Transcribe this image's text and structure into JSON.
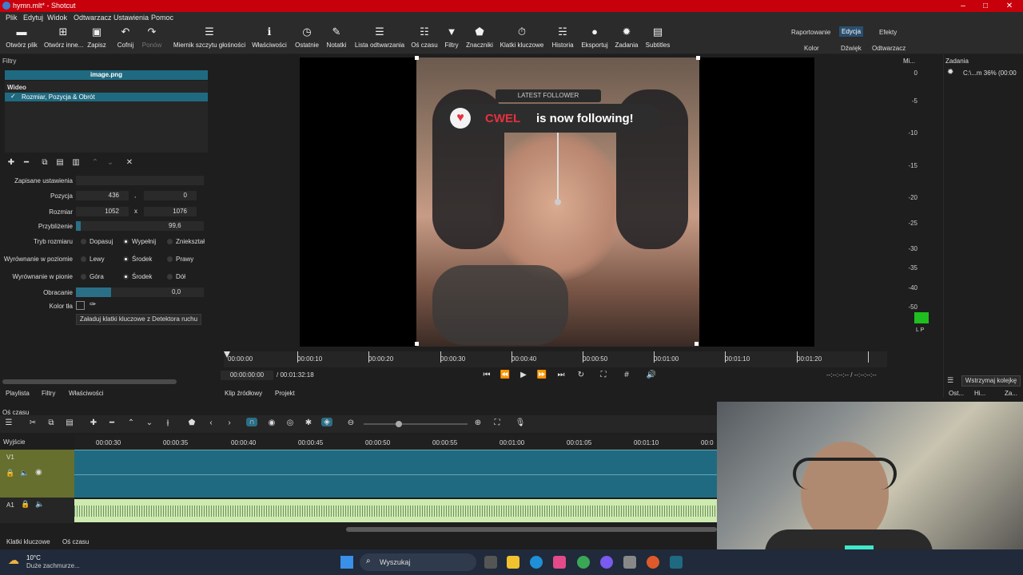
{
  "window": {
    "title": "hymn.mlt* - Shotcut"
  },
  "menu": [
    "Plik",
    "Edytuj",
    "Widok",
    "Odtwarzacz",
    "Ustawienia",
    "Pomoc"
  ],
  "toolbar": [
    {
      "icon": "open-file-icon",
      "label": "Otwórz plik"
    },
    {
      "icon": "open-other-icon",
      "label": "Otwórz inne..."
    },
    {
      "icon": "save-icon",
      "label": "Zapisz"
    },
    {
      "icon": "undo-icon",
      "label": "Cofnij"
    },
    {
      "icon": "redo-icon",
      "label": "Ponów"
    },
    {
      "icon": "loudness-meter-icon",
      "label": "Miernik szczytu głośności"
    },
    {
      "icon": "properties-icon",
      "label": "Właściwości"
    },
    {
      "icon": "recent-icon",
      "label": "Ostatnie"
    },
    {
      "icon": "notes-icon",
      "label": "Notatki"
    },
    {
      "icon": "playlist-icon",
      "label": "Lista odtwarzania"
    },
    {
      "icon": "timeline-icon",
      "label": "Oś czasu"
    },
    {
      "icon": "filter-icon",
      "label": "Filtry"
    },
    {
      "icon": "markers-icon",
      "label": "Znaczniki"
    },
    {
      "icon": "keyframes-icon",
      "label": "Klatki kluczowe"
    },
    {
      "icon": "history-icon",
      "label": "Historia"
    },
    {
      "icon": "export-icon",
      "label": "Eksportuj"
    },
    {
      "icon": "jobs-icon",
      "label": "Zadania"
    },
    {
      "icon": "subtitles-icon",
      "label": "Subtitles"
    }
  ],
  "layouts": {
    "row1": [
      "Raportowanie",
      "Edycja",
      "Efekty"
    ],
    "row2": [
      "Kolor",
      "Dźwięk",
      "Odtwarzacz"
    ],
    "active": "Edycja"
  },
  "filters": {
    "panel_title": "Filtry",
    "clip_name": "image.png",
    "section": "Wideo",
    "filter_item": "Rozmiar, Pozycja & Obrót",
    "preset_label": "Zapisane ustawienia",
    "position_label": "Pozycja",
    "position_x": "436",
    "position_sep": ",",
    "position_y": "0",
    "size_label": "Rozmiar",
    "size_w": "1052",
    "size_sep": "x",
    "size_h": "1076",
    "zoom_label": "Przybliżenie",
    "zoom_value": "99,6",
    "size_mode_label": "Tryb rozmiaru",
    "size_mode_options": [
      "Dopasuj",
      "Wypełnij",
      "Zniekształ"
    ],
    "halign_label": "Wyrównanie w poziomie",
    "halign_options": [
      "Lewy",
      "Środek",
      "Prawy"
    ],
    "valign_label": "Wyrównanie w pionie",
    "valign_options": [
      "Góra",
      "Środek",
      "Dół"
    ],
    "rotation_label": "Obracanie",
    "rotation_value": "0,0",
    "bgcolor_label": "Kolor tła",
    "motion_button": "Załaduj klatki kluczowe z Detektora ruchu"
  },
  "video_overlay": {
    "latest": "LATEST FOLLOWER",
    "name": "CWEL",
    "message": "is now following!"
  },
  "ruler_labels": [
    "00:00:00",
    "00:00:10",
    "00:00:20",
    "00:00:30",
    "00:00:40",
    "00:00:50",
    "00:01:00",
    "00:01:10",
    "00:01:20"
  ],
  "transport": {
    "position": "00:00:00:00",
    "duration": "/ 00:01:32:18",
    "in_out": "--:--:--:-- / --:--:--:--"
  },
  "source_tabs": [
    "Klip źródłowy",
    "Projekt"
  ],
  "left_tabs": [
    "Playlista",
    "Filtry",
    "Właściwości"
  ],
  "meter": {
    "title": "Mi...",
    "scale": [
      "0",
      "-5",
      "-10",
      "-15",
      "-20",
      "-25",
      "-30",
      "-35",
      "-40",
      "-50"
    ],
    "channels": "L P"
  },
  "jobs": {
    "title": "Zadania",
    "item": "C:\\...m 36% (00:00",
    "pause_button": "Wstrzymaj kolejkę",
    "btn1": "Ost...",
    "btn2": "Hi...",
    "btn3": "Za..."
  },
  "timeline": {
    "title": "Oś czasu",
    "output_label": "Wyjście",
    "labels": [
      "00:00:30",
      "00:00:35",
      "00:00:40",
      "00:00:45",
      "00:00:50",
      "00:00:55",
      "00:01:00",
      "00:01:05",
      "00:01:10",
      "00:0"
    ],
    "v1": "V1",
    "a1": "A1"
  },
  "bottom_tabs": [
    "Klatki kluczowe",
    "Oś czasu"
  ],
  "taskbar": {
    "temp": "10°C",
    "weather": "Duże zachmurze...",
    "search": "Wyszukaj"
  }
}
